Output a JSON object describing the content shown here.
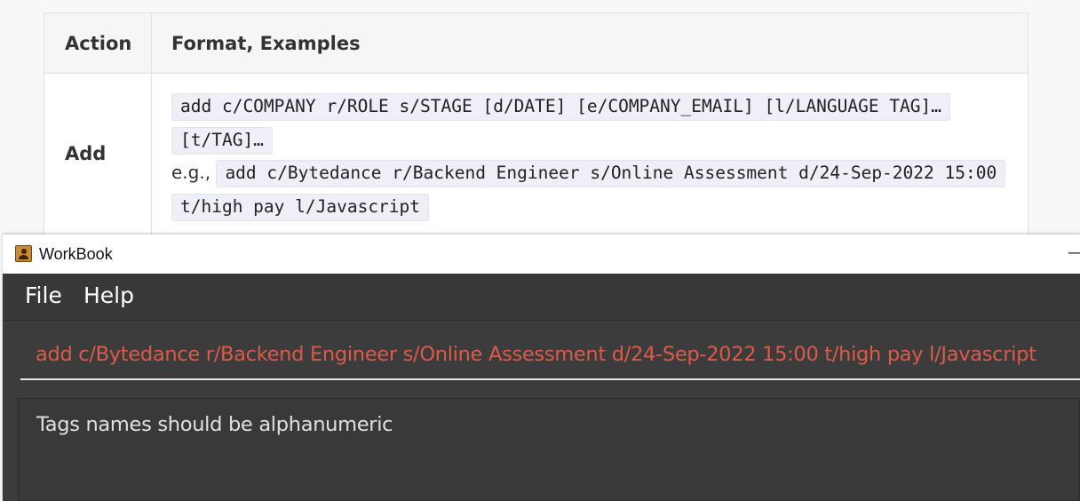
{
  "doc_table": {
    "headers": {
      "action": "Action",
      "format": "Format, Examples"
    },
    "row": {
      "action": "Add",
      "format_code": "add c/COMPANY r/ROLE s/STAGE [d/DATE] [e/COMPANY_EMAIL] [l/LANGUAGE TAG]… [t/TAG]…",
      "example_prefix": "e.g.,",
      "example_code": "add c/Bytedance r/Backend Engineer s/Online Assessment d/24-Sep-2022 15:00 t/high pay l/Javascript"
    }
  },
  "app": {
    "title": "WorkBook",
    "icon": "address-book-icon",
    "minimize_glyph": "—",
    "menu": {
      "file": "File",
      "help": "Help"
    },
    "command_input": {
      "value": "add c/Bytedance r/Backend Engineer s/Online Assessment d/24-Sep-2022 15:00 t/high pay l/Javascript",
      "error_color": "#dd5a48"
    },
    "result_message": "Tags names should be alphanumeric"
  },
  "colors": {
    "window_bg": "#3c3c3c",
    "menu_bg": "#383838",
    "code_bg": "#eff0f7",
    "table_header_bg": "#f6f6f6"
  }
}
